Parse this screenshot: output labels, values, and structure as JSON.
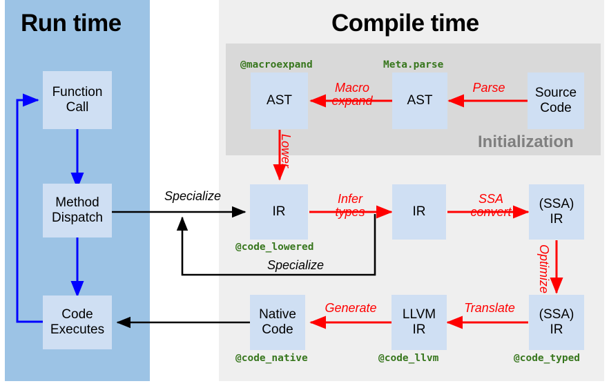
{
  "phases": {
    "runtime_title": "Run time",
    "compile_title": "Compile time",
    "init_title": "Initialization"
  },
  "colors": {
    "runtime_panel": "#9cc3e5",
    "compile_panel": "#efefef",
    "init_panel": "#d9d9d9",
    "node_fill": "#cfdff3",
    "red_arrow": "#ff0000",
    "blue_arrow": "#0000ff",
    "black_arrow": "#000000",
    "annotation_green": "#37761d",
    "init_title_gray": "#7f7f7f"
  },
  "nodes": {
    "function_call": "Function\nCall",
    "function_call_l1": "Function",
    "function_call_l2": "Call",
    "method_dispatch_l1": "Method",
    "method_dispatch_l2": "Dispatch",
    "code_executes_l1": "Code",
    "code_executes_l2": "Executes",
    "source_code_l1": "Source",
    "source_code_l2": "Code",
    "ast_parsed": "AST",
    "ast_expanded": "AST",
    "ir_lowered": "IR",
    "ir_inferred": "IR",
    "ssa_ir_typed_l1": "(SSA)",
    "ssa_ir_typed_l2": "IR",
    "ssa_ir_opt_l1": "(SSA)",
    "ssa_ir_opt_l2": "IR",
    "llvm_ir_l1": "LLVM",
    "llvm_ir_l2": "IR",
    "native_code_l1": "Native",
    "native_code_l2": "Code"
  },
  "annotations": {
    "macroexpand": "@macroexpand",
    "meta_parse": "Meta.parse",
    "code_lowered": "@code_lowered",
    "code_native": "@code_native",
    "code_llvm": "@code_llvm",
    "code_typed": "@code_typed"
  },
  "edges": {
    "parse": "Parse",
    "macro_expand_l1": "Macro",
    "macro_expand_l2": "expand",
    "lower": "Lower",
    "infer_types_l1": "Infer",
    "infer_types_l2": "types",
    "ssa_convert_l1": "SSA",
    "ssa_convert_l2": "convert",
    "optimize": "Optimize",
    "translate": "Translate",
    "generate": "Generate",
    "specialize_top": "Specialize",
    "specialize_loop": "Specialize"
  }
}
